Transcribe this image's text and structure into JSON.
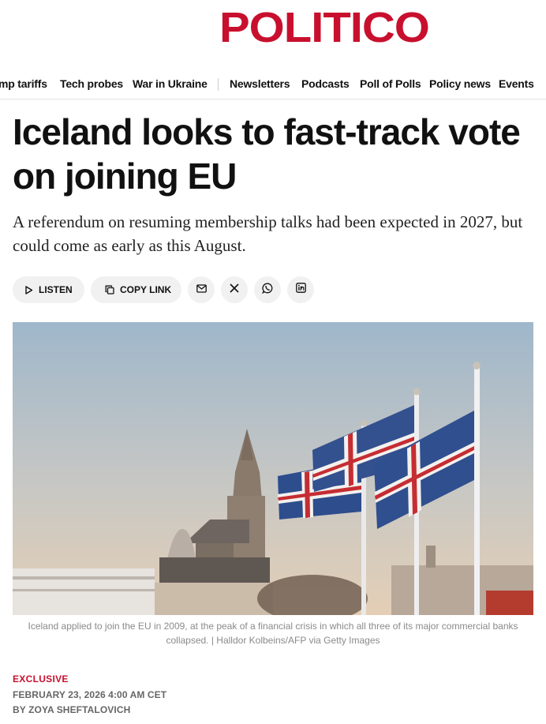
{
  "brand": {
    "logo_text": "POLITICO",
    "accent_color": "#c8102e"
  },
  "nav": {
    "topics": [
      "mp tariffs",
      "Tech probes",
      "War in Ukraine"
    ],
    "sections": [
      "Newsletters",
      "Podcasts",
      "Poll of Polls",
      "Policy news",
      "Events"
    ]
  },
  "article": {
    "headline": "Iceland looks to fast-track vote on joining EU",
    "dek": "A referendum on resuming membership talks had been expected in 2027, but could come as early as this August.",
    "share": {
      "listen_label": "LISTEN",
      "copy_link_label": "COPY LINK",
      "icons": [
        "mail-icon",
        "x-icon",
        "whatsapp-icon",
        "linkedin-icon"
      ]
    },
    "image": {
      "subject": "Icelandic flags flying in front of Hallgrímskirkja church",
      "caption": "Iceland applied to join the EU in 2009, at the peak of a financial crisis in which all three of its major commercial banks collapsed. | Halldor Kolbeins/AFP via Getty Images"
    },
    "kicker": "EXCLUSIVE",
    "date": "FEBRUARY 23, 2026 4:00 AM CET",
    "byline": "BY ZOYA SHEFTALOVICH"
  }
}
